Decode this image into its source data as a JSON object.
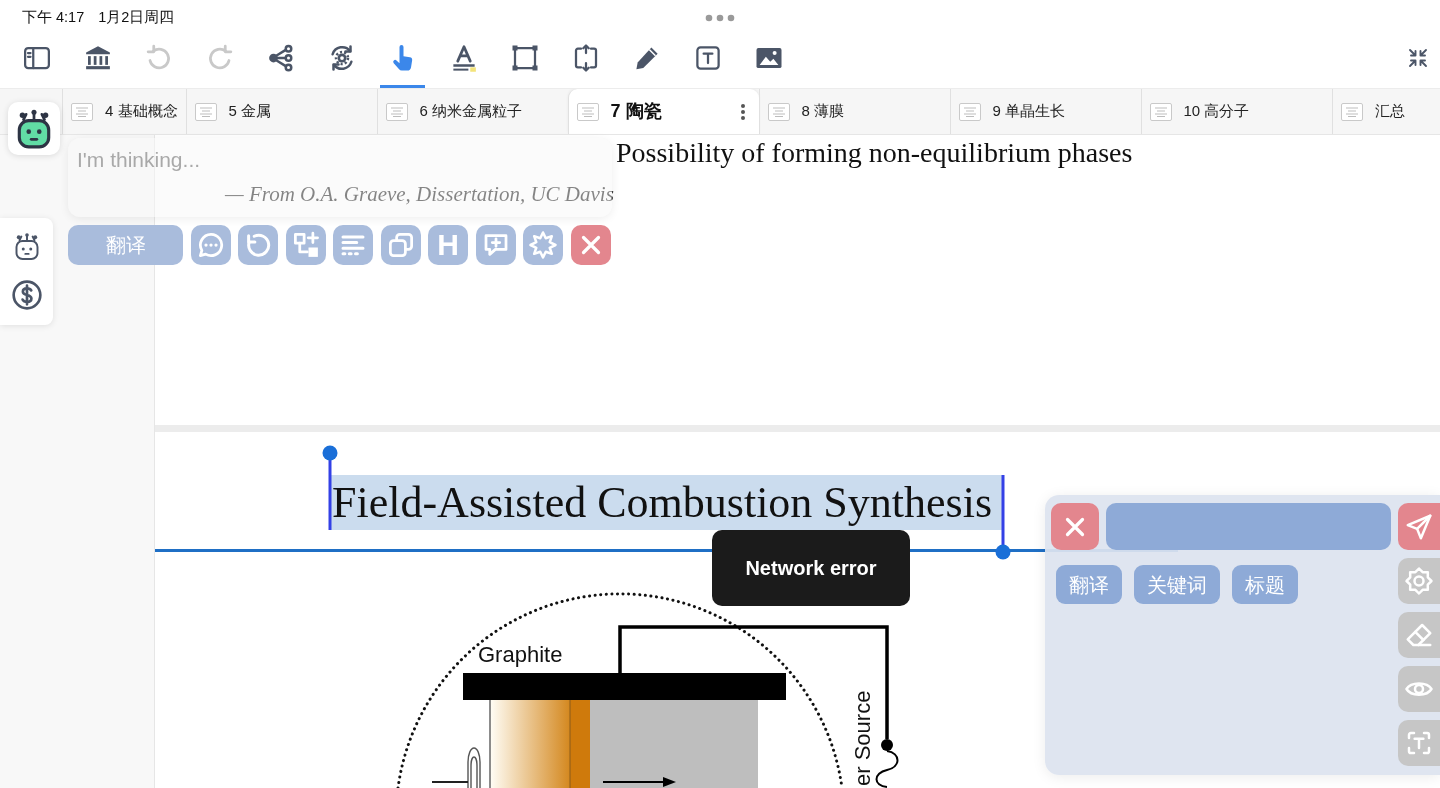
{
  "status_bar": {
    "time": "下午 4:17",
    "date": "1月2日周四"
  },
  "toolbar": [
    {
      "kind": "sidebar",
      "selected": false,
      "disabled": false
    },
    {
      "kind": "library",
      "selected": false,
      "disabled": false
    },
    {
      "kind": "undo",
      "selected": false,
      "disabled": true
    },
    {
      "kind": "redo",
      "selected": false,
      "disabled": true
    },
    {
      "kind": "share",
      "selected": false,
      "disabled": false
    },
    {
      "kind": "sync",
      "selected": false,
      "disabled": false
    },
    {
      "kind": "pointer",
      "selected": true,
      "disabled": false
    },
    {
      "kind": "highlight",
      "selected": false,
      "disabled": false
    },
    {
      "kind": "select",
      "selected": false,
      "disabled": false
    },
    {
      "kind": "resize",
      "selected": false,
      "disabled": false
    },
    {
      "kind": "pen",
      "selected": false,
      "disabled": false
    },
    {
      "kind": "textbox",
      "selected": false,
      "disabled": false
    },
    {
      "kind": "image",
      "selected": false,
      "disabled": false
    }
  ],
  "tabs": [
    {
      "label": "4 基础概念",
      "selected": false
    },
    {
      "label": "5 金属",
      "selected": false
    },
    {
      "label": "6 纳米金属粒子",
      "selected": false
    },
    {
      "label": "7 陶瓷",
      "selected": true
    },
    {
      "label": "8 薄膜",
      "selected": false
    },
    {
      "label": "9 单晶生长",
      "selected": false
    },
    {
      "label": "10 高分子",
      "selected": false
    },
    {
      "label": "汇总",
      "selected": false
    }
  ],
  "document": {
    "page_1": {
      "heading": "Possibility of forming non-equilibrium phases",
      "attribution": "— From O.A. Graeve, Dissertation, UC Davis"
    },
    "page_2": {
      "title": "Field-Assisted Combustion Synthesis",
      "title_selected": true,
      "figure": {
        "graphite_label": "Graphite",
        "source_label": "er Source"
      }
    }
  },
  "assistant": {
    "placeholder": "I'm thinking...",
    "actions": [
      {
        "kind": "text",
        "label": "翻译"
      },
      {
        "kind": "chat"
      },
      {
        "kind": "retry"
      },
      {
        "kind": "add-block"
      },
      {
        "kind": "lines"
      },
      {
        "kind": "copy"
      },
      {
        "kind": "letter",
        "label": "H"
      },
      {
        "kind": "comment"
      },
      {
        "kind": "burst"
      },
      {
        "kind": "close"
      }
    ]
  },
  "side_panel": [
    {
      "kind": "robot"
    },
    {
      "kind": "dollar"
    }
  ],
  "toast": "Network error",
  "quick_panel": {
    "chips": [
      "翻译",
      "关键词",
      "标题"
    ],
    "tools": [
      {
        "kind": "settings"
      },
      {
        "kind": "eraser"
      },
      {
        "kind": "eye"
      },
      {
        "kind": "text-scan"
      }
    ]
  }
}
